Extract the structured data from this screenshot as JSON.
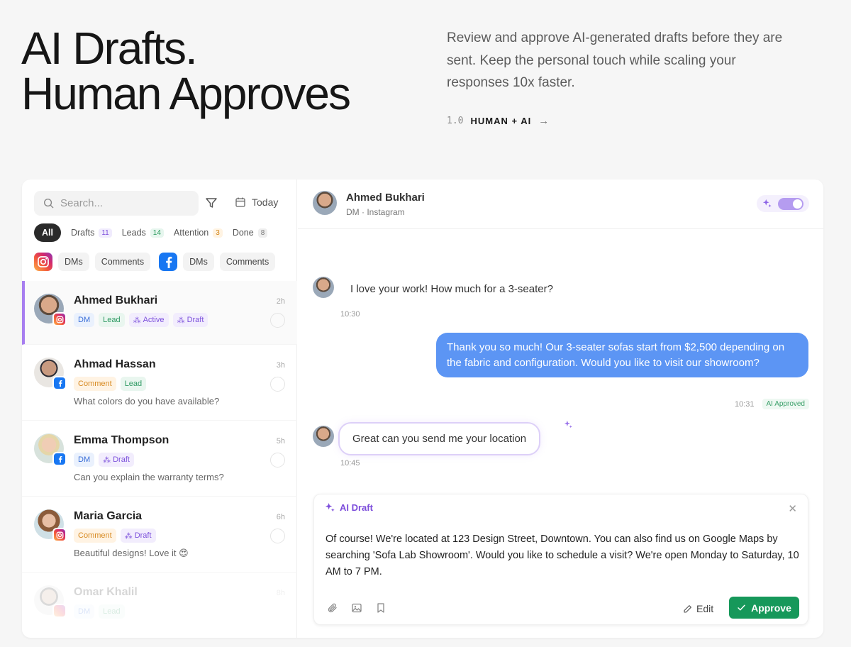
{
  "hero": {
    "title_line1": "AI Drafts.",
    "title_line2": "Human Approves",
    "description": "Review and approve AI-generated drafts before they are sent. Keep the personal touch while scaling your responses 10x faster.",
    "tag_number": "1.0",
    "tag_label": "HUMAN + AI"
  },
  "sidebar": {
    "search_placeholder": "Search...",
    "date_filter": "Today",
    "tabs": [
      {
        "label": "All"
      },
      {
        "label": "Drafts",
        "count": "11"
      },
      {
        "label": "Leads",
        "count": "14"
      },
      {
        "label": "Attention",
        "count": "3"
      },
      {
        "label": "Done",
        "count": "8"
      }
    ],
    "instagram_filters": [
      "DMs",
      "Comments"
    ],
    "facebook_filters": [
      "DMs",
      "Comments"
    ]
  },
  "conversations": [
    {
      "name": "Ahmed Bukhari",
      "time": "2h",
      "platform": "instagram",
      "tags": [
        "DM",
        "Lead",
        "Active",
        "Draft"
      ],
      "message": ""
    },
    {
      "name": "Ahmad Hassan",
      "time": "3h",
      "platform": "facebook",
      "tags": [
        "Comment",
        "Lead"
      ],
      "message": "What colors do you have available?"
    },
    {
      "name": "Emma Thompson",
      "time": "5h",
      "platform": "facebook",
      "tags": [
        "DM",
        "Draft"
      ],
      "message": "Can you explain the warranty terms?"
    },
    {
      "name": "Maria Garcia",
      "time": "6h",
      "platform": "instagram",
      "tags": [
        "Comment",
        "Draft"
      ],
      "message": "Beautiful designs! Love it 😍"
    },
    {
      "name": "Omar Khalil",
      "time": "8h",
      "platform": "instagram",
      "tags": [
        "DM",
        "Lead"
      ],
      "message": ""
    }
  ],
  "chat": {
    "contact_name": "Ahmed Bukhari",
    "contact_sub": "DM · Instagram",
    "messages": [
      {
        "direction": "in",
        "text": "I love your work! How much for a 3-seater?",
        "time": "10:30"
      },
      {
        "direction": "out",
        "text": "Thank you so much! Our 3-seater sofas start from $2,500 depending on the fabric and configuration. Would you like to visit our showroom?",
        "time": "10:31",
        "status": "AI Approved"
      },
      {
        "direction": "in",
        "text": "Great can you send me your location",
        "time": "10:45"
      }
    ]
  },
  "draft": {
    "title": "AI Draft",
    "text": "Of course! We're located at 123 Design Street, Downtown. You can also find us on Google Maps by searching 'Sofa Lab Showroom'. Would you like to schedule a visit? We're open Monday to Saturday, 10 AM to 7 PM.",
    "edit_label": "Edit",
    "approve_label": "Approve"
  },
  "colors": {
    "accent_purple": "#a77ef0",
    "bubble_blue": "#5c95f4",
    "approve_green": "#16985a"
  }
}
